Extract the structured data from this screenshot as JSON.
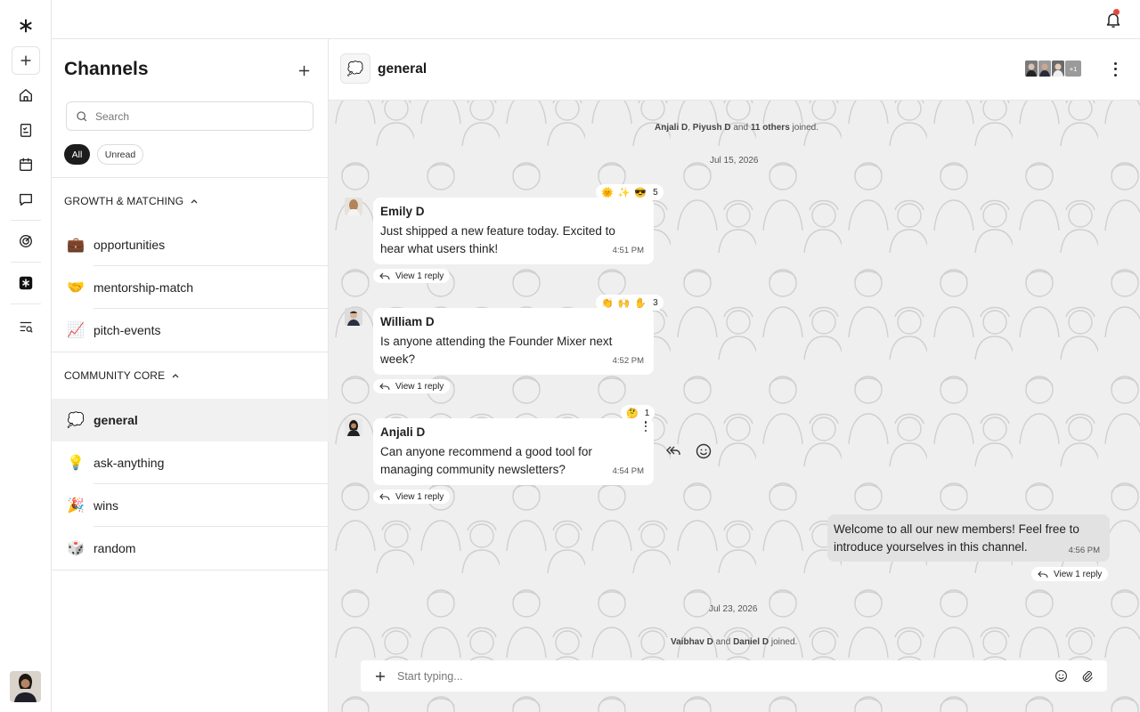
{
  "rail": {
    "items": [
      "logo-icon",
      "add-icon",
      "home-icon",
      "tasks-icon",
      "calendar-icon",
      "chat-icon",
      "target-icon",
      "app-icon",
      "search-list-icon"
    ]
  },
  "channels_panel": {
    "title": "Channels",
    "search_placeholder": "Search",
    "filters": [
      "All",
      "Unread"
    ],
    "sections": [
      {
        "name": "GROWTH & MATCHING",
        "channels": [
          {
            "emoji": "💼",
            "name": "opportunities"
          },
          {
            "emoji": "🤝",
            "name": "mentorship-match"
          },
          {
            "emoji": "📈",
            "name": "pitch-events"
          }
        ]
      },
      {
        "name": "COMMUNITY CORE",
        "channels": [
          {
            "emoji": "💭",
            "name": "general",
            "active": true
          },
          {
            "emoji": "💡",
            "name": "ask-anything"
          },
          {
            "emoji": "🎉",
            "name": "wins"
          },
          {
            "emoji": "🎲",
            "name": "random"
          }
        ]
      }
    ]
  },
  "chat": {
    "channel_emoji": "💭",
    "title": "general",
    "members_more": "+1",
    "joined_1": {
      "a": "Anjali D",
      "sep1": ", ",
      "b": "Piyush D",
      "sep2": " and ",
      "c": "11 others",
      "suffix": " joined."
    },
    "date_1": "Jul 15, 2026",
    "messages": [
      {
        "sender": "Emily D",
        "text": "Just shipped a new feature today. Excited to hear what users think!",
        "time": "4:51 PM",
        "reactions": [
          "🌞",
          "✨",
          "😎"
        ],
        "reaction_count": "5",
        "reply": "View 1 reply"
      },
      {
        "sender": "William D",
        "text": "Is anyone attending the Founder Mixer next week?",
        "time": "4:52 PM",
        "reactions": [
          "👏",
          "🙌",
          "✋"
        ],
        "reaction_count": "3",
        "reply": "View 1 reply"
      },
      {
        "sender": "Anjali D",
        "text": "Can anyone recommend a good tool for managing community newsletters?",
        "time": "4:54 PM",
        "reactions": [
          "🤔"
        ],
        "reaction_count": "1",
        "reply": "View 1 reply"
      }
    ],
    "own_message": {
      "text": "Welcome to all our new members! Feel free to introduce yourselves in this channel.",
      "time": "4:56 PM",
      "reply": "View 1 reply"
    },
    "date_2": "Jul 23, 2026",
    "joined_2": {
      "a": "Vaibhav D",
      "sep1": " and ",
      "b": "Daniel D",
      "suffix": " joined."
    },
    "composer_placeholder": "Start typing..."
  },
  "colors": {
    "accent_dark": "#1c1c1c",
    "chat_bg": "#efefef",
    "own_bubble": "#e2e2e2",
    "notification_dot": "#e5483d"
  }
}
